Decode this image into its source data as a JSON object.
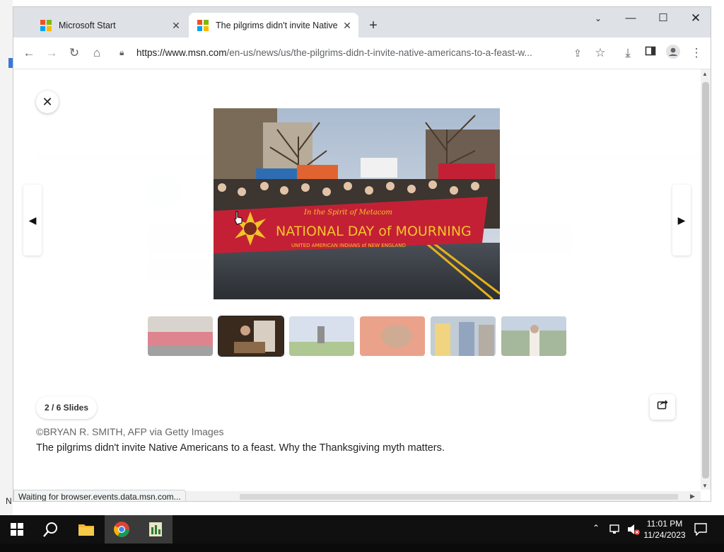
{
  "browser": {
    "tabs": [
      {
        "title": "Microsoft Start",
        "active": false
      },
      {
        "title": "The pilgrims didn't invite Native",
        "active": true
      }
    ],
    "url_host": "https://www.msn.com",
    "url_path": "/en-us/news/us/the-pilgrims-didn-t-invite-native-americans-to-a-feast-w...",
    "status_text": "Waiting for browser.events.data.msn.com..."
  },
  "gallery": {
    "slide_counter": "2 / 6 Slides",
    "credit": "©BRYAN R. SMITH, AFP via Getty Images",
    "caption": "The pilgrims didn't invite Native Americans to a feast. Why the Thanksgiving myth matters.",
    "banner_script": "In the Spirit of Metacom",
    "banner_title": "NATIONAL DAY of MOURNING",
    "banner_sub": "UNITED AMERICAN INDIANS of NEW ENGLAND",
    "active_thumbnail": 2,
    "thumbnail_count": 6
  },
  "taskbar": {
    "time": "11:01 PM",
    "date": "11/24/2023"
  },
  "desktop": {
    "edge_char": "N"
  },
  "colors": {
    "accent_blue": "#3a78d6",
    "banner_red": "#c42035",
    "taskbar": "#101010"
  }
}
